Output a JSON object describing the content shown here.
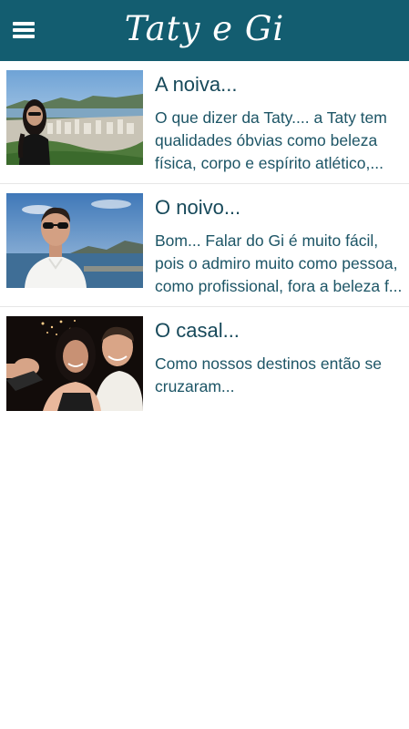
{
  "app": {
    "title": "Taty e Gi",
    "menu_icon": "hamburger-menu-icon",
    "header_color": "#135d70"
  },
  "posts": [
    {
      "title": "A noiva...",
      "excerpt": "O que dizer da Taty.... a Taty tem qualidades óbvias como beleza física, corpo e espírito atlético,...",
      "image": "bride-photo"
    },
    {
      "title": "O noivo...",
      "excerpt": "Bom... Falar do Gi é muito fácil, pois o admiro muito como pessoa, como profissional, fora a beleza f...",
      "image": "groom-photo"
    },
    {
      "title": "O casal...",
      "excerpt": "Como nossos destinos então se cruzaram...",
      "image": "couple-photo"
    }
  ]
}
